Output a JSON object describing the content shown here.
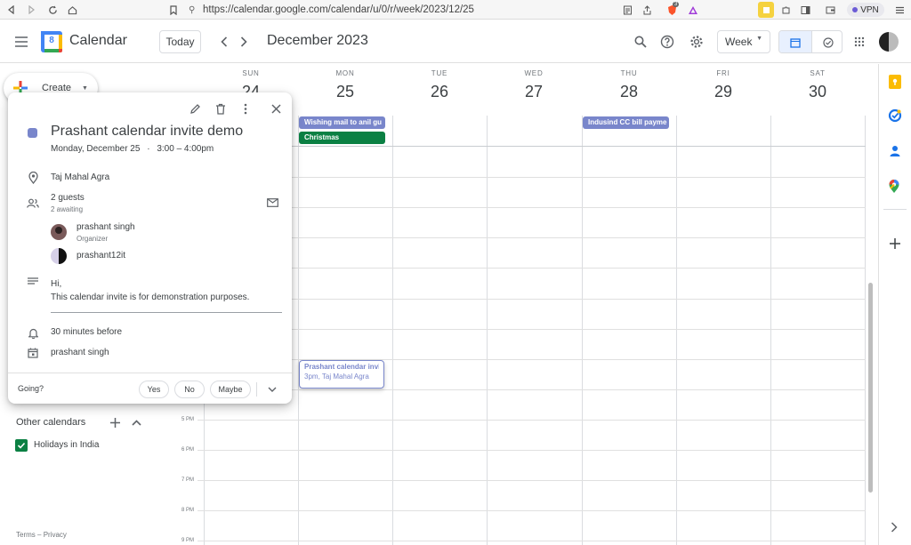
{
  "browser": {
    "url": "https://calendar.google.com/calendar/u/0/r/week/2023/12/25",
    "vpn_label": "VPN",
    "brave_badge": "3"
  },
  "header": {
    "app_name": "Calendar",
    "logo_number": "8",
    "today_label": "Today",
    "period_title": "December 2023",
    "view_select": "Week"
  },
  "sidebar": {
    "create_label": "Create",
    "other_calendars_label": "Other calendars",
    "calendars": [
      {
        "label": "Holidays in India",
        "checked": true,
        "color": "#0b8043"
      }
    ],
    "footer": {
      "terms": "Terms",
      "sep": "–",
      "privacy": "Privacy"
    }
  },
  "days": [
    {
      "name": "SUN",
      "num": "24"
    },
    {
      "name": "MON",
      "num": "25"
    },
    {
      "name": "TUE",
      "num": "26"
    },
    {
      "name": "WED",
      "num": "27"
    },
    {
      "name": "THU",
      "num": "28"
    },
    {
      "name": "FRI",
      "num": "29"
    },
    {
      "name": "SAT",
      "num": "30"
    }
  ],
  "time_labels": [
    "5 PM",
    "6 PM",
    "7 PM",
    "8 PM",
    "9 PM"
  ],
  "allday_events": [
    {
      "title": "Wishing mail to anil gu",
      "color": "#7986cb"
    },
    {
      "title": "Christmas",
      "color": "#0b8043"
    },
    {
      "title": "Indusind CC bill payme",
      "color": "#7986cb"
    }
  ],
  "timed_event": {
    "title": "Prashant calendar invite",
    "subtitle": "3pm, Taj Mahal Agra",
    "color": "#7986cb"
  },
  "popup": {
    "title": "Prashant calendar invite demo",
    "date": "Monday, December 25",
    "dot": "·",
    "time": "3:00 – 4:00pm",
    "location": "Taj Mahal Agra",
    "guests_count": "2 guests",
    "guests_status": "2 awaiting",
    "guests": [
      {
        "name": "prashant singh",
        "role": "Organizer"
      },
      {
        "name": "prashant12it",
        "role": ""
      }
    ],
    "description_line1": "Hi,",
    "description_line2": "This calendar invite is for demonstration purposes.",
    "reminder": "30 minutes before",
    "calendar_owner": "prashant singh",
    "going_label": "Going?",
    "yes": "Yes",
    "no": "No",
    "maybe": "Maybe",
    "color": "#7986cb"
  },
  "colors": {
    "accent": "#1a73e8",
    "selected_view_bg": "#e8f0fe"
  }
}
